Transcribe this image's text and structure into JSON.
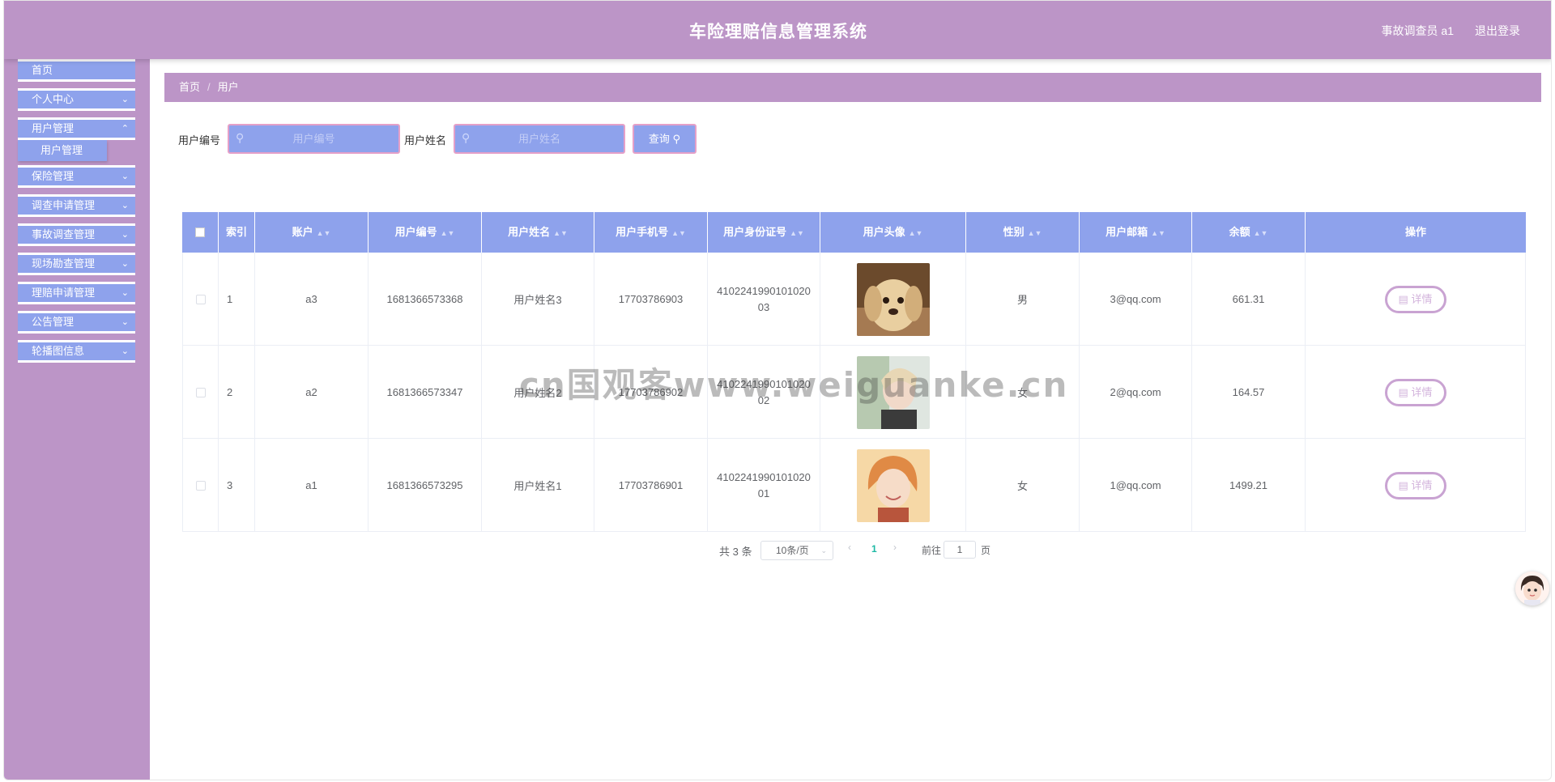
{
  "header": {
    "title": "车险理赔信息管理系统",
    "user_role": "事故调查员 a1",
    "logout": "退出登录"
  },
  "sidebar": {
    "items": [
      {
        "label": "首页",
        "has_children": false
      },
      {
        "label": "个人中心",
        "has_children": true
      },
      {
        "label": "用户管理",
        "has_children": true,
        "expanded": true,
        "children": [
          "用户管理"
        ]
      },
      {
        "label": "保险管理",
        "has_children": true
      },
      {
        "label": "调查申请管理",
        "has_children": true
      },
      {
        "label": "事故调查管理",
        "has_children": true
      },
      {
        "label": "现场勘查管理",
        "has_children": true
      },
      {
        "label": "理赔申请管理",
        "has_children": true
      },
      {
        "label": "公告管理",
        "has_children": true
      },
      {
        "label": "轮播图信息",
        "has_children": true
      }
    ]
  },
  "breadcrumb": {
    "home": "首页",
    "separator": "/",
    "current": "用户"
  },
  "search": {
    "user_no_label": "用户编号",
    "user_no_placeholder": "用户编号",
    "user_no_value": "",
    "user_name_label": "用户姓名",
    "user_name_placeholder": "用户姓名",
    "user_name_value": "",
    "query_button": "查询"
  },
  "table": {
    "columns": [
      "索引",
      "账户",
      "用户编号",
      "用户姓名",
      "用户手机号",
      "用户身份证号",
      "用户头像",
      "性别",
      "用户邮箱",
      "余额",
      "操作"
    ],
    "rows": [
      {
        "index": "1",
        "account": "a3",
        "user_no": "1681366573368",
        "name": "用户姓名3",
        "phone": "17703786903",
        "id_card": "410224199010102003",
        "avatar": "puppy-photo",
        "gender": "男",
        "email": "3@qq.com",
        "balance": "661.31",
        "action": "详情"
      },
      {
        "index": "2",
        "account": "a2",
        "user_no": "1681366573347",
        "name": "用户姓名2",
        "phone": "17703786902",
        "id_card": "410224199010102002",
        "avatar": "person-photo",
        "gender": "女",
        "email": "2@qq.com",
        "balance": "164.57",
        "action": "详情"
      },
      {
        "index": "3",
        "account": "a1",
        "user_no": "1681366573295",
        "name": "用户姓名1",
        "phone": "17703786901",
        "id_card": "410224199010102001",
        "avatar": "person-photo",
        "gender": "女",
        "email": "1@qq.com",
        "balance": "1499.21",
        "action": "详情"
      }
    ]
  },
  "pagination": {
    "total": "共 3 条",
    "page_size": "10条/页",
    "current_page": "1",
    "goto_label": "前往",
    "goto_value": "1",
    "page_suffix": "页"
  },
  "watermark": "cn国观客www.weiguanke.cn",
  "colors": {
    "header_bg": "#bc95c7",
    "accent_blue": "#8ea2ec",
    "pink_border": "#e5a0c8",
    "active_page": "#1db9a4"
  }
}
